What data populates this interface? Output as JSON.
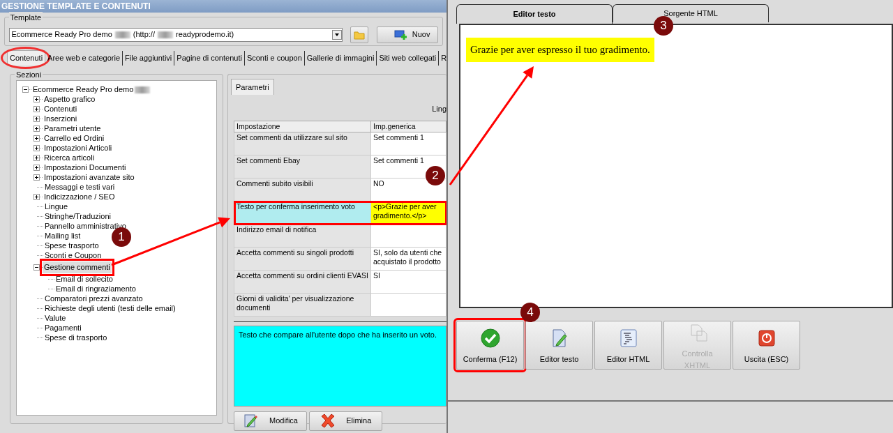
{
  "main_window": {
    "title": "GESTIONE TEMPLATE E CONTENUTI",
    "template": {
      "label": "Template",
      "value": [
        "Ecommerce Ready Pro demo",
        "(http://",
        "readyprodemo.it)"
      ],
      "new_button": "Nuov"
    },
    "tabs": [
      {
        "label": "Contenuti",
        "selected": true,
        "circled": true
      },
      {
        "label": "Aree web e categorie",
        "selected": false
      },
      {
        "label": "File aggiuntivi",
        "selected": false
      },
      {
        "label": "Pagine di contenuti",
        "selected": false
      },
      {
        "label": "Sconti e coupon",
        "selected": false
      },
      {
        "label": "Gallerie di immagini",
        "selected": false
      },
      {
        "label": "Siti web collegati",
        "selected": false
      },
      {
        "label": "R",
        "selected": false
      }
    ],
    "sections": {
      "label": "Sezioni",
      "tree": [
        {
          "label": "Ecommerce Ready Pro demo",
          "redacted": true,
          "expanded": true,
          "selected": false,
          "highlighted": false,
          "children": [
            {
              "label": "Aspetto grafico",
              "expanded": false,
              "selected": false,
              "highlighted": false
            },
            {
              "label": "Contenuti",
              "expanded": false,
              "selected": false,
              "highlighted": false
            },
            {
              "label": "Inserzioni",
              "expanded": false,
              "selected": false,
              "highlighted": false
            },
            {
              "label": "Parametri utente",
              "expanded": false,
              "selected": false,
              "highlighted": false
            },
            {
              "label": "Carrello ed Ordini",
              "expanded": false,
              "selected": false,
              "highlighted": false
            },
            {
              "label": "Impostazioni Articoli",
              "expanded": false,
              "selected": false,
              "highlighted": false
            },
            {
              "label": "Ricerca articoli",
              "expanded": false,
              "selected": false,
              "highlighted": false
            },
            {
              "label": "Impostazioni Documenti",
              "expanded": false,
              "selected": false,
              "highlighted": false
            },
            {
              "label": "Impostazioni avanzate sito",
              "expanded": false,
              "selected": false,
              "highlighted": false
            },
            {
              "label": "Messaggi e testi vari",
              "selected": false,
              "highlighted": false
            },
            {
              "label": "Indicizzazione / SEO",
              "expanded": false,
              "selected": false,
              "highlighted": false
            },
            {
              "label": "Lingue",
              "selected": false,
              "highlighted": false
            },
            {
              "label": "Stringhe/Traduzioni",
              "selected": false,
              "highlighted": false
            },
            {
              "label": "Pannello amministrativo",
              "selected": false,
              "highlighted": false
            },
            {
              "label": "Mailing list",
              "selected": false,
              "highlighted": false
            },
            {
              "label": "Spese trasporto",
              "selected": false,
              "highlighted": false
            },
            {
              "label": "Sconti e Coupon",
              "selected": false,
              "highlighted": false
            },
            {
              "label": "Gestione commenti",
              "expanded": true,
              "selected": true,
              "highlighted": true,
              "children": [
                {
                  "label": "Email di sollecito",
                  "selected": false,
                  "highlighted": false
                },
                {
                  "label": "Email di ringraziamento",
                  "selected": false,
                  "highlighted": false
                }
              ]
            },
            {
              "label": "Comparatori prezzi avanzato",
              "selected": false,
              "highlighted": false
            },
            {
              "label": "Richieste degli utenti (testi delle email)",
              "selected": false,
              "highlighted": false
            },
            {
              "label": "Valute",
              "selected": false,
              "highlighted": false
            },
            {
              "label": "Pagamenti",
              "selected": false,
              "highlighted": false
            },
            {
              "label": "Spese di trasporto",
              "selected": false,
              "highlighted": false
            }
          ]
        }
      ]
    },
    "params": {
      "tab": "Parametri",
      "language_label": "Ling",
      "columns": [
        "Impostazione",
        "Imp.generica"
      ],
      "rows": [
        {
          "setting": [
            "Set commenti da utilizzare sul sito"
          ],
          "value": [
            "Set commenti 1"
          ],
          "selected": false,
          "highlighted": false
        },
        {
          "setting": [
            "Set commenti Ebay"
          ],
          "value": [
            "Set commenti 1"
          ],
          "selected": false,
          "highlighted": false
        },
        {
          "setting": [
            "Commenti subito visibili"
          ],
          "value": [
            "NO"
          ],
          "selected": false,
          "highlighted": false
        },
        {
          "setting": [
            "Testo per conferma inserimento voto"
          ],
          "value": [
            "<p>Grazie per aver",
            "gradimento.</p>"
          ],
          "selected": true,
          "highlighted": true
        },
        {
          "setting": [
            "Indirizzo email di notifica"
          ],
          "value": [],
          "selected": false,
          "highlighted": false
        },
        {
          "setting": [
            "Accetta commenti su singoli prodotti"
          ],
          "value": [
            "SI, solo da utenti che",
            "acquistato il prodotto"
          ],
          "selected": false,
          "highlighted": false
        },
        {
          "setting": [
            "Accetta commenti su ordini clienti EVASI"
          ],
          "value": [
            "SI"
          ],
          "selected": false,
          "highlighted": false
        },
        {
          "setting": [
            "Giorni di validita' per visualizzazione",
            "documenti"
          ],
          "value": [],
          "selected": false,
          "highlighted": false
        }
      ],
      "description": "Testo che compare all'utente dopo che ha inserito un voto.",
      "buttons": [
        {
          "label": "Modifica",
          "kind": "edit"
        },
        {
          "label": "Elimina",
          "kind": "delete"
        }
      ]
    }
  },
  "editor_dialog": {
    "tabs": [
      {
        "label": "Editor testo",
        "selected": true
      },
      {
        "label": "Sorgente HTML",
        "selected": false
      }
    ],
    "content": "Grazie per aver espresso il tuo gradimento.",
    "buttons": [
      {
        "label": "Conferma (F12)",
        "kind": "confirm",
        "disabled": false,
        "highlighted": true
      },
      {
        "label": "Editor testo",
        "kind": "text",
        "disabled": false,
        "highlighted": false
      },
      {
        "label": "Editor HTML",
        "kind": "html",
        "disabled": false,
        "highlighted": false
      },
      {
        "label": "Controlla XHTML",
        "kind": "validate",
        "disabled": true,
        "highlighted": false
      },
      {
        "label": "Uscita (ESC)",
        "kind": "exit",
        "disabled": false,
        "highlighted": false
      }
    ]
  },
  "annotations": [
    {
      "number": "1"
    },
    {
      "number": "2"
    },
    {
      "number": "3"
    },
    {
      "number": "4"
    }
  ]
}
